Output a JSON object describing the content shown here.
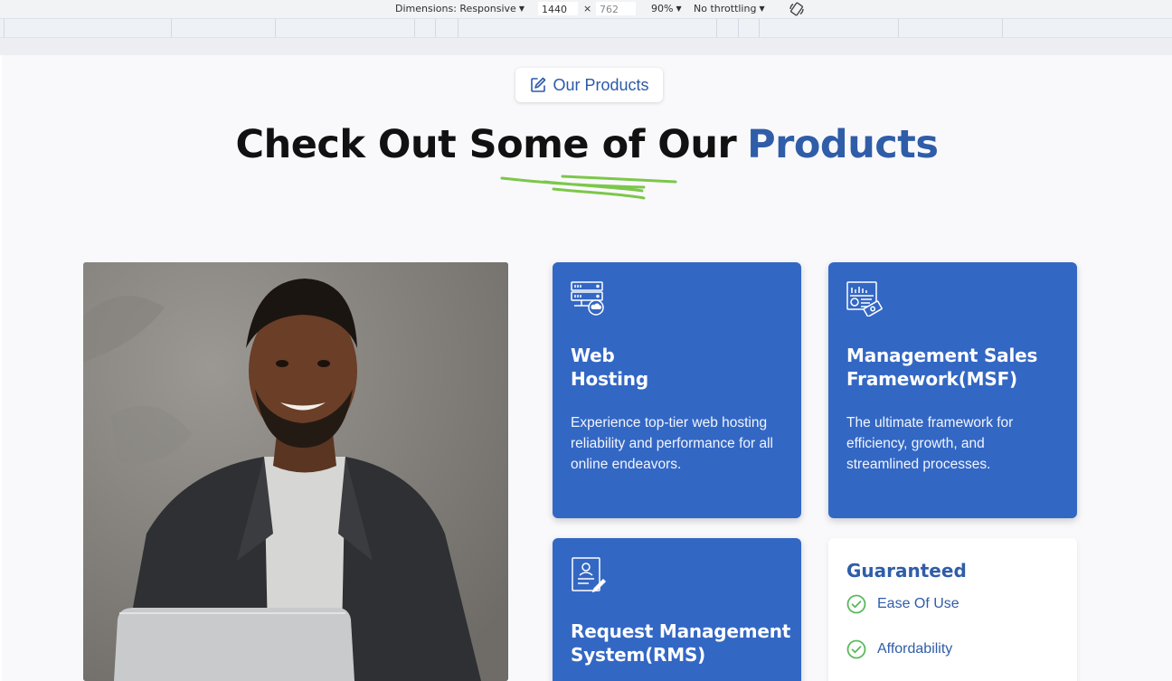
{
  "devtools": {
    "dimensions_label": "Dimensions: Responsive",
    "width": "1440",
    "height": "762",
    "zoom": "90%",
    "throttling": "No throttling",
    "times": "×"
  },
  "section": {
    "badge": "Our Products",
    "headline_main": "Check Out Some of Our",
    "headline_accent": "Products"
  },
  "cards": [
    {
      "title_line1": "Web",
      "title_line2": "Hosting",
      "description": "Experience top-tier web hosting reliability and performance for all online endeavors.",
      "icon": "server-cloud-icon"
    },
    {
      "title_line1": "Management Sales",
      "title_line2": "Framework(MSF)",
      "description": "The ultimate framework for efficiency, growth, and streamlined processes.",
      "icon": "sales-chart-icon"
    },
    {
      "title_line1": "Request Management",
      "title_line2": "System(RMS)",
      "description": "",
      "icon": "request-document-icon"
    }
  ],
  "guaranteed": {
    "title": "Guaranteed",
    "items": [
      "Ease Of Use",
      "Affordability"
    ]
  },
  "colors": {
    "card_blue": "#3367c4",
    "accent_blue": "#2f5da8",
    "check_green": "#5bb85d",
    "squiggle_green": "#7cc74a"
  }
}
